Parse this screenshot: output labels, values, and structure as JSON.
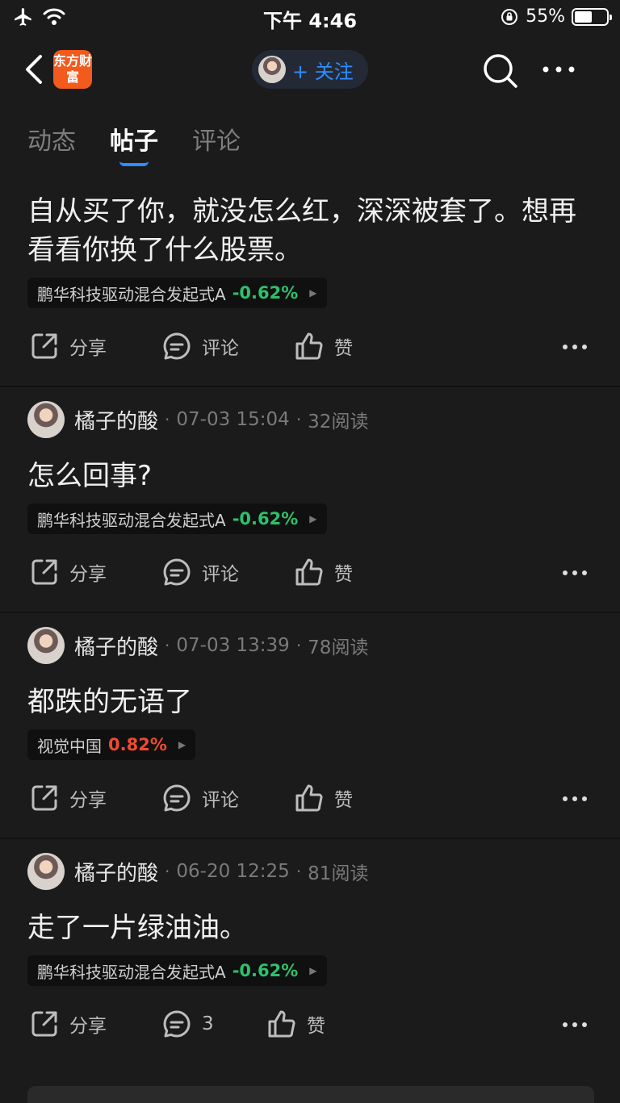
{
  "status_bar": {
    "time": "下午 4:46",
    "battery_text": "55%",
    "battery_level": 0.55
  },
  "nav": {
    "logo_text": "东方财富",
    "follow_label": "+ 关注"
  },
  "tabs": [
    {
      "label": "动态",
      "active": false
    },
    {
      "label": "帖子",
      "active": true
    },
    {
      "label": "评论",
      "active": false
    }
  ],
  "actions": {
    "share": "分享",
    "comment": "评论",
    "like": "赞"
  },
  "posts": [
    {
      "content": "自从买了你，就没怎么红，深深被套了。想再看看你换了什么股票。",
      "stock": {
        "name": "鹏华科技驱动混合发起式A",
        "change": "-0.62%",
        "direction": "down"
      }
    },
    {
      "author": "橘子的酸",
      "date": "07-03 15:04",
      "reads": "32阅读",
      "content": "怎么回事?",
      "stock": {
        "name": "鹏华科技驱动混合发起式A",
        "change": "-0.62%",
        "direction": "down"
      }
    },
    {
      "author": "橘子的酸",
      "date": "07-03 13:39",
      "reads": "78阅读",
      "content": "都跌的无语了",
      "stock": {
        "name": "视觉中国",
        "change": "0.82%",
        "direction": "up"
      }
    },
    {
      "author": "橘子的酸",
      "date": "06-20 12:25",
      "reads": "81阅读",
      "content": "走了一片绿油油。",
      "stock": {
        "name": "鹏华科技驱动混合发起式A",
        "change": "-0.62%",
        "direction": "down"
      },
      "comment_count": "3"
    }
  ],
  "colors": {
    "accent": "#2f8cff",
    "down": "#2fc06b",
    "up": "#f0492f",
    "logo": "#f25a1e"
  }
}
